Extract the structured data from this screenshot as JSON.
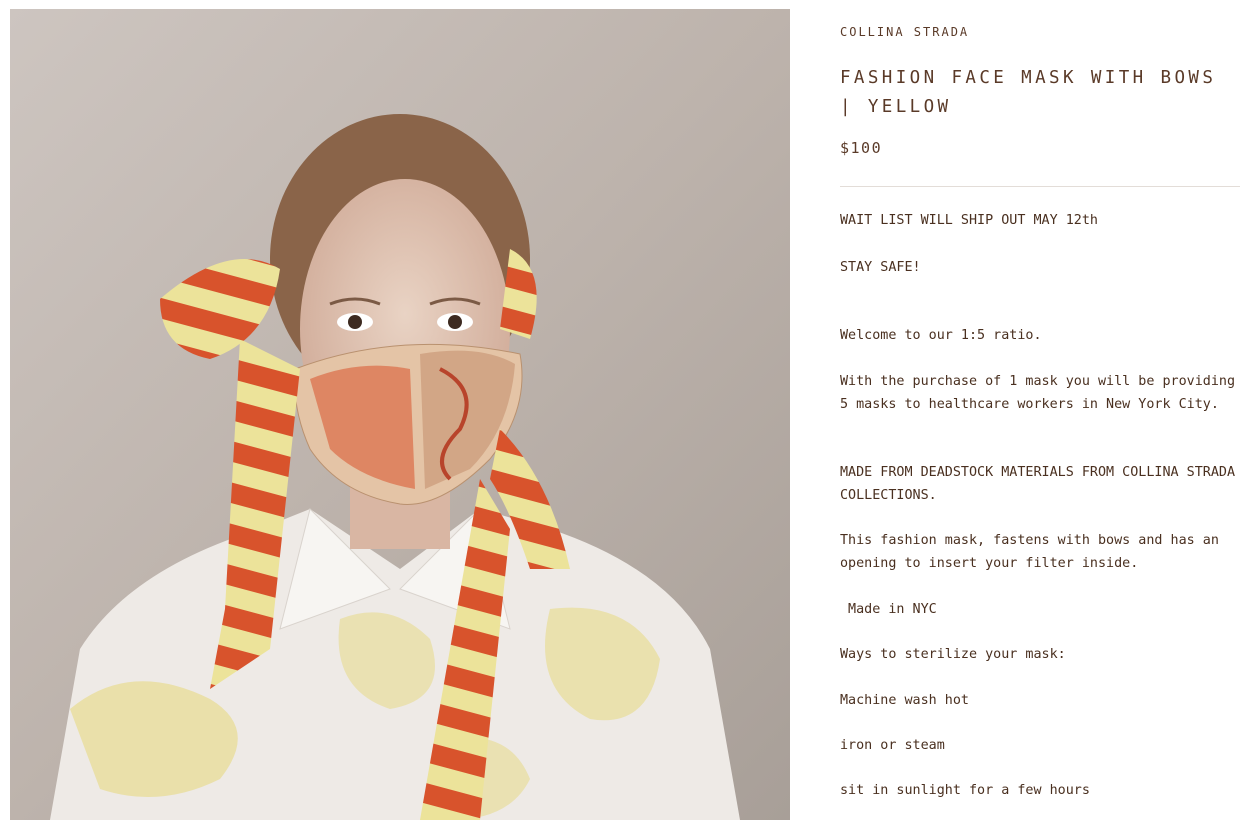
{
  "product": {
    "vendor": "COLLINA STRADA",
    "title": "FASHION FACE MASK WITH BOWS | YELLOW",
    "price": "$100",
    "image_alt": "Model wearing fashion face mask with bows"
  },
  "description": {
    "lines": [
      "WAIT LIST WILL SHIP OUT MAY 12th",
      "STAY SAFE!",
      "Welcome to our 1:5 ratio.",
      "With the purchase of 1 mask you will be providing 5 masks to healthcare workers in New York City.",
      "MADE FROM DEADSTOCK MATERIALS FROM COLLINA STRADA COLLECTIONS.",
      "This fashion mask, fastens with bows and has an opening to insert your filter inside.",
      " Made in NYC",
      "Ways to sterilize your mask:",
      "Machine wash hot",
      "iron or steam",
      "sit in sunlight for a few hours"
    ]
  },
  "colors": {
    "text": "#5a3a28",
    "divider": "#e3ddd8",
    "mask_orange": "#d8532c",
    "mask_yellow": "#ece39a"
  }
}
